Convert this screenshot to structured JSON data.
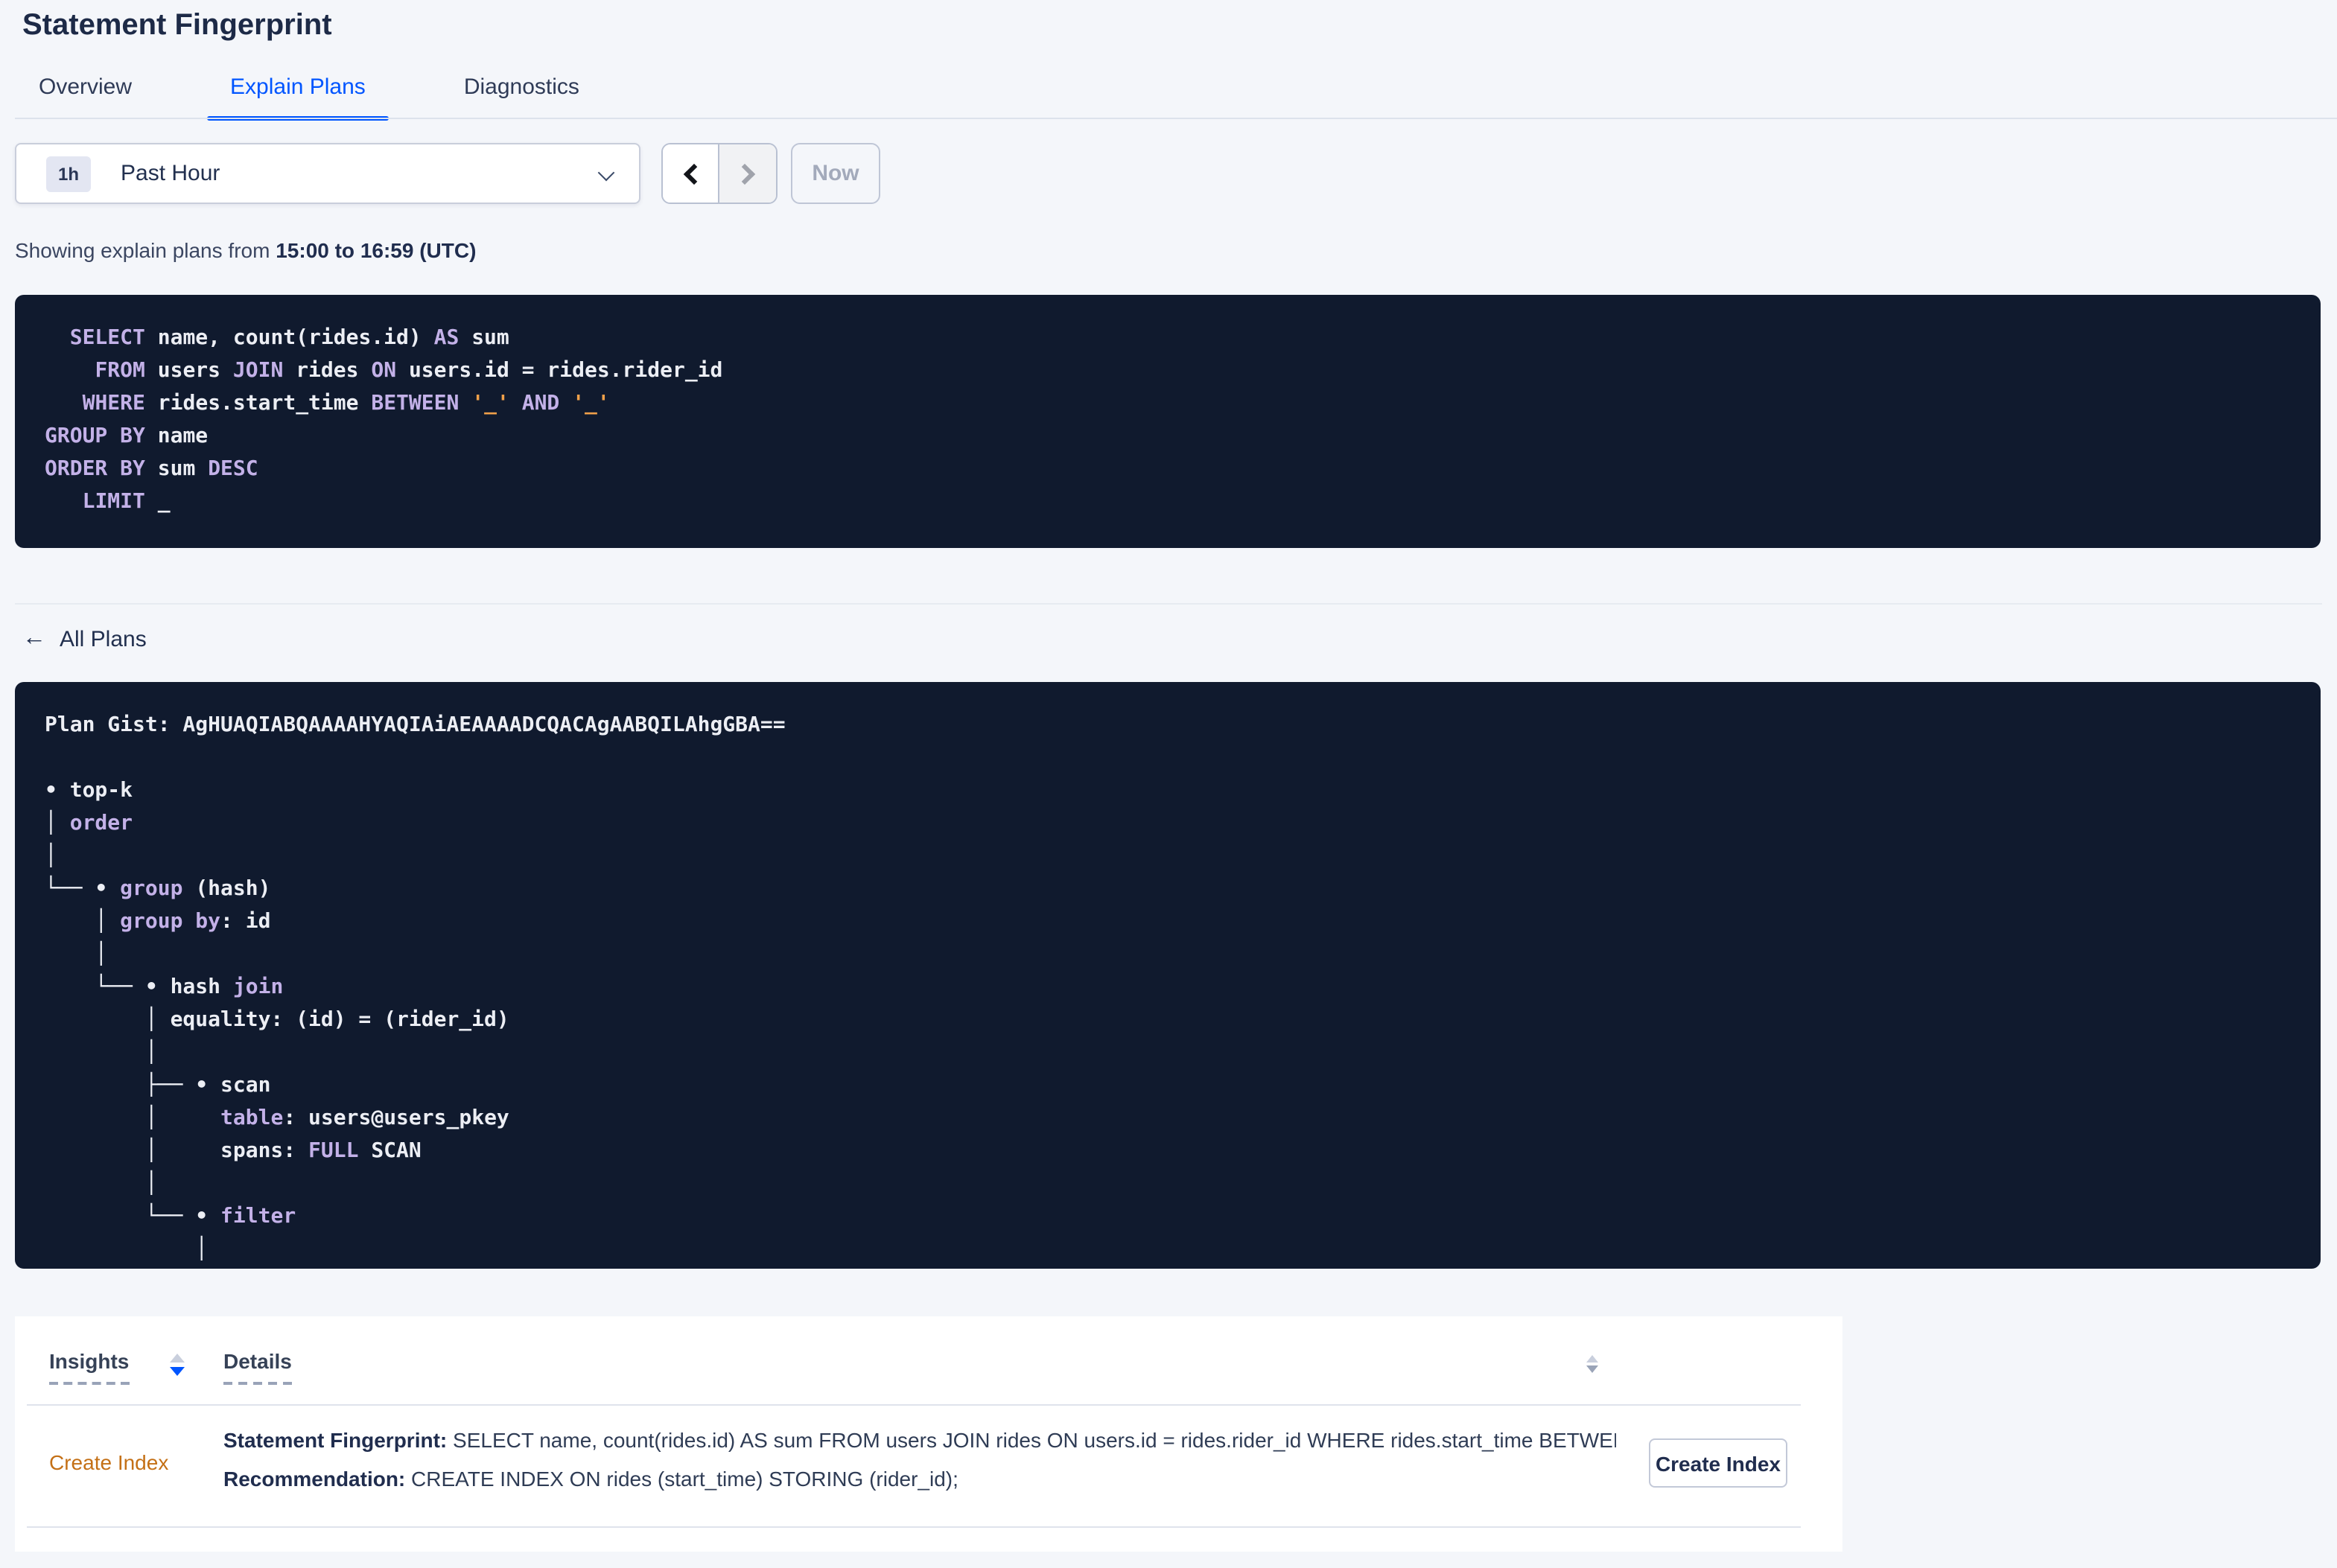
{
  "page": {
    "title": "Statement Fingerprint"
  },
  "tabs": [
    {
      "label": "Overview",
      "active": false
    },
    {
      "label": "Explain Plans",
      "active": true
    },
    {
      "label": "Diagnostics",
      "active": false
    }
  ],
  "time_picker": {
    "interval_badge": "1h",
    "selected_range": "Past Hour",
    "now_label": "Now",
    "icons": {
      "dropdown": "chevron-down-icon",
      "prev": "chevron-left-icon",
      "next": "chevron-right-icon"
    },
    "prev_enabled": true,
    "next_enabled": false,
    "now_enabled": false
  },
  "showing": {
    "prefix": "Showing explain plans from ",
    "range_bold": "15:00 to 16:59 (UTC)"
  },
  "sql": {
    "lines": [
      [
        [
          "pl",
          "  "
        ],
        [
          "kw",
          "SELECT"
        ],
        [
          "pl",
          " name, count(rides.id) "
        ],
        [
          "kw",
          "AS"
        ],
        [
          "pl",
          " sum"
        ]
      ],
      [
        [
          "pl",
          "    "
        ],
        [
          "kw",
          "FROM"
        ],
        [
          "pl",
          " users "
        ],
        [
          "kw",
          "JOIN"
        ],
        [
          "pl",
          " rides "
        ],
        [
          "kw",
          "ON"
        ],
        [
          "pl",
          " users.id = rides.rider_id"
        ]
      ],
      [
        [
          "pl",
          "   "
        ],
        [
          "kw",
          "WHERE"
        ],
        [
          "pl",
          " rides.start_time "
        ],
        [
          "kw",
          "BETWEEN"
        ],
        [
          "pl",
          " "
        ],
        [
          "lit",
          "'_'"
        ],
        [
          "pl",
          " "
        ],
        [
          "kw",
          "AND"
        ],
        [
          "pl",
          " "
        ],
        [
          "lit",
          "'_'"
        ]
      ],
      [
        [
          "kw",
          "GROUP BY"
        ],
        [
          "pl",
          " name"
        ]
      ],
      [
        [
          "kw",
          "ORDER BY"
        ],
        [
          "pl",
          " sum "
        ],
        [
          "kw",
          "DESC"
        ]
      ],
      [
        [
          "pl",
          "   "
        ],
        [
          "kw",
          "LIMIT"
        ],
        [
          "pl",
          " _"
        ]
      ]
    ]
  },
  "all_plans": {
    "back_icon": "arrow-left-icon",
    "back_glyph": "←",
    "label": "All Plans"
  },
  "plan": {
    "lines": [
      [
        [
          "pl",
          "Plan Gist: AgHUAQIABQAAAAHYAQIAiAEAAAADCQACAgAABQILAhgGBA=="
        ]
      ],
      [
        [
          "pl",
          ""
        ]
      ],
      [
        [
          "pl",
          "• top-k"
        ]
      ],
      [
        [
          "pl",
          "│ "
        ],
        [
          "kw",
          "order"
        ]
      ],
      [
        [
          "pl",
          "│"
        ]
      ],
      [
        [
          "pl",
          "└── • "
        ],
        [
          "kw",
          "group"
        ],
        [
          "pl",
          " (hash)"
        ]
      ],
      [
        [
          "pl",
          "    │ "
        ],
        [
          "kw",
          "group by"
        ],
        [
          "pl",
          ": id"
        ]
      ],
      [
        [
          "pl",
          "    │"
        ]
      ],
      [
        [
          "pl",
          "    └── • hash "
        ],
        [
          "kw",
          "join"
        ]
      ],
      [
        [
          "pl",
          "        │ equality: (id) = (rider_id)"
        ]
      ],
      [
        [
          "pl",
          "        │"
        ]
      ],
      [
        [
          "pl",
          "        ├── • scan"
        ]
      ],
      [
        [
          "pl",
          "        │     "
        ],
        [
          "kw",
          "table"
        ],
        [
          "pl",
          ": users@users_pkey"
        ]
      ],
      [
        [
          "pl",
          "        │     spans: "
        ],
        [
          "kw",
          "FULL"
        ],
        [
          "pl",
          " SCAN"
        ]
      ],
      [
        [
          "pl",
          "        │"
        ]
      ],
      [
        [
          "pl",
          "        └── • "
        ],
        [
          "kw",
          "filter"
        ]
      ],
      [
        [
          "pl",
          "            │"
        ]
      ]
    ]
  },
  "insights_table": {
    "columns": [
      {
        "label": "Insights",
        "sort": "desc"
      },
      {
        "label": "Details",
        "sort": "none"
      }
    ],
    "row": {
      "insight": "Create Index",
      "detail_1_label": "Statement Fingerprint:",
      "detail_1_text": " SELECT name, count(rides.id) AS sum FROM users JOIN rides ON users.id = rides.rider_id WHERE rides.start_time BETWEEN '_…",
      "detail_2_label": "Recommendation:",
      "detail_2_text": " CREATE INDEX ON rides (start_time) STORING (rider_id);",
      "action_label": "Create Index"
    }
  },
  "colors": {
    "accent_blue": "#0055ff",
    "page_bg": "#f4f6fa",
    "code_bg": "#101a2e",
    "code_keyword": "#c3b1e8",
    "code_literal": "#f0a04a",
    "code_text": "#eceef4",
    "insight_orange": "#c47016",
    "title_navy": "#1d2a47"
  }
}
